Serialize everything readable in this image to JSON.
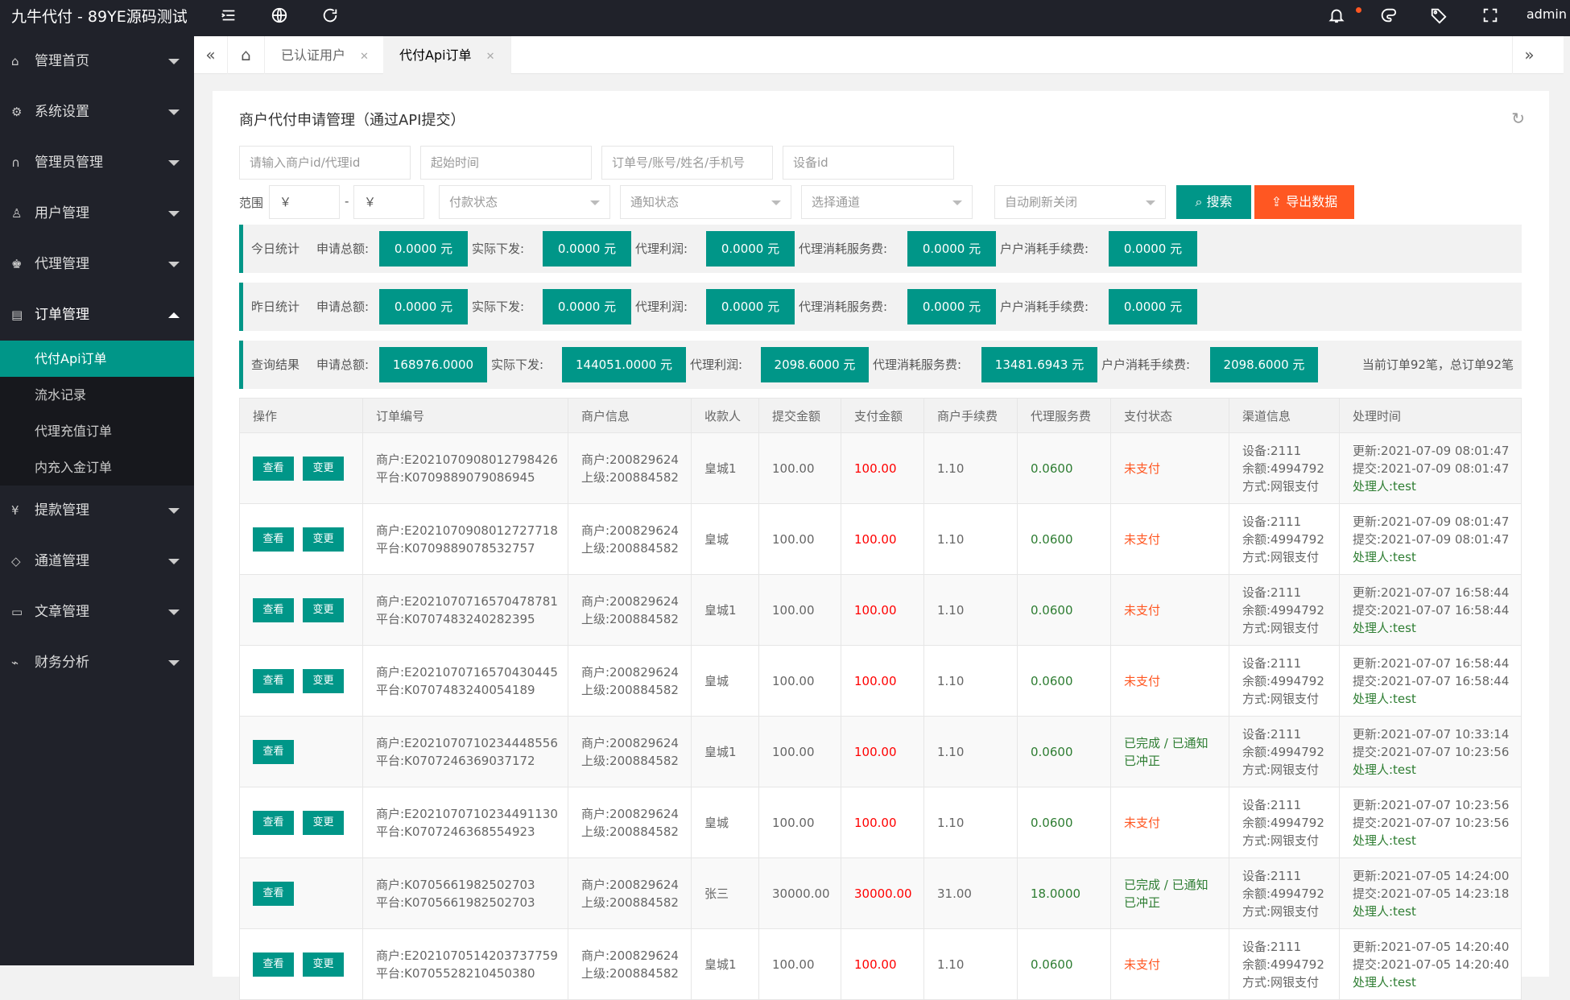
{
  "header": {
    "brand": "九牛代付 - 89YE源码测试",
    "user": "admin",
    "icons": [
      "menu-fold-icon",
      "globe-icon",
      "refresh-icon",
      "bell-icon",
      "theme-icon",
      "tag-icon",
      "fullscreen-icon"
    ]
  },
  "sidebar": {
    "items": [
      {
        "label": "管理首页",
        "icon": "home-icon"
      },
      {
        "label": "系统设置",
        "icon": "gear-icon"
      },
      {
        "label": "管理员管理",
        "icon": "headset-icon"
      },
      {
        "label": "用户管理",
        "icon": "user-icon"
      },
      {
        "label": "代理管理",
        "icon": "agent-icon"
      },
      {
        "label": "订单管理",
        "icon": "order-icon"
      },
      {
        "label": "提款管理",
        "icon": "yen-icon"
      },
      {
        "label": "通道管理",
        "icon": "diamond-icon"
      },
      {
        "label": "文章管理",
        "icon": "document-icon"
      },
      {
        "label": "财务分析",
        "icon": "chart-icon"
      }
    ],
    "sub": [
      "代付Api订单",
      "流水记录",
      "代理充值订单",
      "内充入金订单"
    ]
  },
  "tabs": {
    "t1": "已认证用户",
    "t2": "代付Api订单"
  },
  "page": {
    "title": "商户代付申请管理（通过API提交）"
  },
  "filters": {
    "merchant": "请输入商户id/代理id",
    "start": "起始时间",
    "order": "订单号/账号/姓名/手机号",
    "device": "设备id",
    "range_label": "范围",
    "yen1": "￥",
    "yen2": "￥",
    "dash": "-",
    "pay_status": "付款状态",
    "notify_status": "通知状态",
    "channel": "选择通道",
    "auto_refresh": "自动刷新关闭",
    "search": "搜索",
    "export": "导出数据"
  },
  "stats": {
    "today": {
      "label": "今日统计",
      "apply_l": "申请总额:",
      "apply": "0.0000 元",
      "actual_l": "实际下发:",
      "actual": "0.0000 元",
      "profit_l": "代理利润:",
      "profit": "0.0000 元",
      "fee_l": "代理消耗服务费:",
      "fee": "0.0000 元",
      "mfee_l": "户户消耗手续费:",
      "mfee": "0.0000 元"
    },
    "yesterday": {
      "label": "昨日统计",
      "apply_l": "申请总额:",
      "apply": "0.0000 元",
      "actual_l": "实际下发:",
      "actual": "0.0000 元",
      "profit_l": "代理利润:",
      "profit": "0.0000 元",
      "fee_l": "代理消耗服务费:",
      "fee": "0.0000 元",
      "mfee_l": "户户消耗手续费:",
      "mfee": "0.0000 元"
    },
    "query": {
      "label": "查询结果",
      "apply_l": "申请总额:",
      "apply": "168976.0000",
      "actual_l": "实际下发:",
      "actual": "144051.0000 元",
      "profit_l": "代理利润:",
      "profit": "2098.6000 元",
      "fee_l": "代理消耗服务费:",
      "fee": "13481.6943 元",
      "mfee_l": "户户消耗手续费:",
      "mfee": "2098.6000 元",
      "summary": "当前订单92笔，总订单92笔"
    }
  },
  "table": {
    "headers": [
      "操作",
      "订单编号",
      "商户信息",
      "收款人",
      "提交金额",
      "支付金额",
      "商户手续费",
      "代理服务费",
      "支付状态",
      "渠道信息",
      "处理时间"
    ],
    "view": "查看",
    "change": "变更",
    "rows": [
      {
        "o1": "商户:E2021070908012798426",
        "o2": "平台:K0709889079086945",
        "m1": "商户:200829624",
        "m2": "上级:200884582",
        "payee": "皇城1",
        "submit": "100.00",
        "paid": "100.00",
        "mfee": "1.10",
        "afee": "0.0600",
        "s1": "未支付",
        "s2": "",
        "c1": "设备:2111",
        "c2": "余额:4994792",
        "c3": "方式:网银支付",
        "t1": "更新:2021-07-09 08:01:47",
        "t2": "提交:2021-07-09 08:01:47",
        "t3": "处理人:test",
        "change": true
      },
      {
        "o1": "商户:E2021070908012727718",
        "o2": "平台:K0709889078532757",
        "m1": "商户:200829624",
        "m2": "上级:200884582",
        "payee": "皇城",
        "submit": "100.00",
        "paid": "100.00",
        "mfee": "1.10",
        "afee": "0.0600",
        "s1": "未支付",
        "s2": "",
        "c1": "设备:2111",
        "c2": "余额:4994792",
        "c3": "方式:网银支付",
        "t1": "更新:2021-07-09 08:01:47",
        "t2": "提交:2021-07-09 08:01:47",
        "t3": "处理人:test",
        "change": true
      },
      {
        "o1": "商户:E2021070716570478781",
        "o2": "平台:K0707483240282395",
        "m1": "商户:200829624",
        "m2": "上级:200884582",
        "payee": "皇城1",
        "submit": "100.00",
        "paid": "100.00",
        "mfee": "1.10",
        "afee": "0.0600",
        "s1": "未支付",
        "s2": "",
        "c1": "设备:2111",
        "c2": "余额:4994792",
        "c3": "方式:网银支付",
        "t1": "更新:2021-07-07 16:58:44",
        "t2": "提交:2021-07-07 16:58:44",
        "t3": "处理人:test",
        "change": true
      },
      {
        "o1": "商户:E2021070716570430445",
        "o2": "平台:K0707483240054189",
        "m1": "商户:200829624",
        "m2": "上级:200884582",
        "payee": "皇城",
        "submit": "100.00",
        "paid": "100.00",
        "mfee": "1.10",
        "afee": "0.0600",
        "s1": "未支付",
        "s2": "",
        "c1": "设备:2111",
        "c2": "余额:4994792",
        "c3": "方式:网银支付",
        "t1": "更新:2021-07-07 16:58:44",
        "t2": "提交:2021-07-07 16:58:44",
        "t3": "处理人:test",
        "change": true
      },
      {
        "o1": "商户:E2021070710234448556",
        "o2": "平台:K0707246369037172",
        "m1": "商户:200829624",
        "m2": "上级:200884582",
        "payee": "皇城1",
        "submit": "100.00",
        "paid": "100.00",
        "mfee": "1.10",
        "afee": "0.0600",
        "s1": "已完成 / 已通知",
        "s2": "已冲正",
        "c1": "设备:2111",
        "c2": "余额:4994792",
        "c3": "方式:网银支付",
        "t1": "更新:2021-07-07 10:33:14",
        "t2": "提交:2021-07-07 10:23:56",
        "t3": "处理人:test",
        "change": false
      },
      {
        "o1": "商户:E2021070710234491130",
        "o2": "平台:K0707246368554923",
        "m1": "商户:200829624",
        "m2": "上级:200884582",
        "payee": "皇城",
        "submit": "100.00",
        "paid": "100.00",
        "mfee": "1.10",
        "afee": "0.0600",
        "s1": "未支付",
        "s2": "",
        "c1": "设备:2111",
        "c2": "余额:4994792",
        "c3": "方式:网银支付",
        "t1": "更新:2021-07-07 10:23:56",
        "t2": "提交:2021-07-07 10:23:56",
        "t3": "处理人:test",
        "change": true
      },
      {
        "o1": "商户:K0705661982502703",
        "o2": "平台:K0705661982502703",
        "m1": "商户:200829624",
        "m2": "上级:200884582",
        "payee": "张三",
        "submit": "30000.00",
        "paid": "30000.00",
        "mfee": "31.00",
        "afee": "18.0000",
        "s1": "已完成 / 已通知",
        "s2": "已冲正",
        "c1": "设备:2111",
        "c2": "余额:4994792",
        "c3": "方式:网银支付",
        "t1": "更新:2021-07-05 14:24:00",
        "t2": "提交:2021-07-05 14:23:18",
        "t3": "处理人:test",
        "change": false
      },
      {
        "o1": "商户:E2021070514203737759",
        "o2": "平台:K0705528210450380",
        "m1": "商户:200829624",
        "m2": "上级:200884582",
        "payee": "皇城1",
        "submit": "100.00",
        "paid": "100.00",
        "mfee": "1.10",
        "afee": "0.0600",
        "s1": "未支付",
        "s2": "",
        "c1": "设备:2111",
        "c2": "余额:4994792",
        "c3": "方式:网银支付",
        "t1": "更新:2021-07-05 14:20:40",
        "t2": "提交:2021-07-05 14:20:40",
        "t3": "处理人:test",
        "change": true
      }
    ]
  }
}
